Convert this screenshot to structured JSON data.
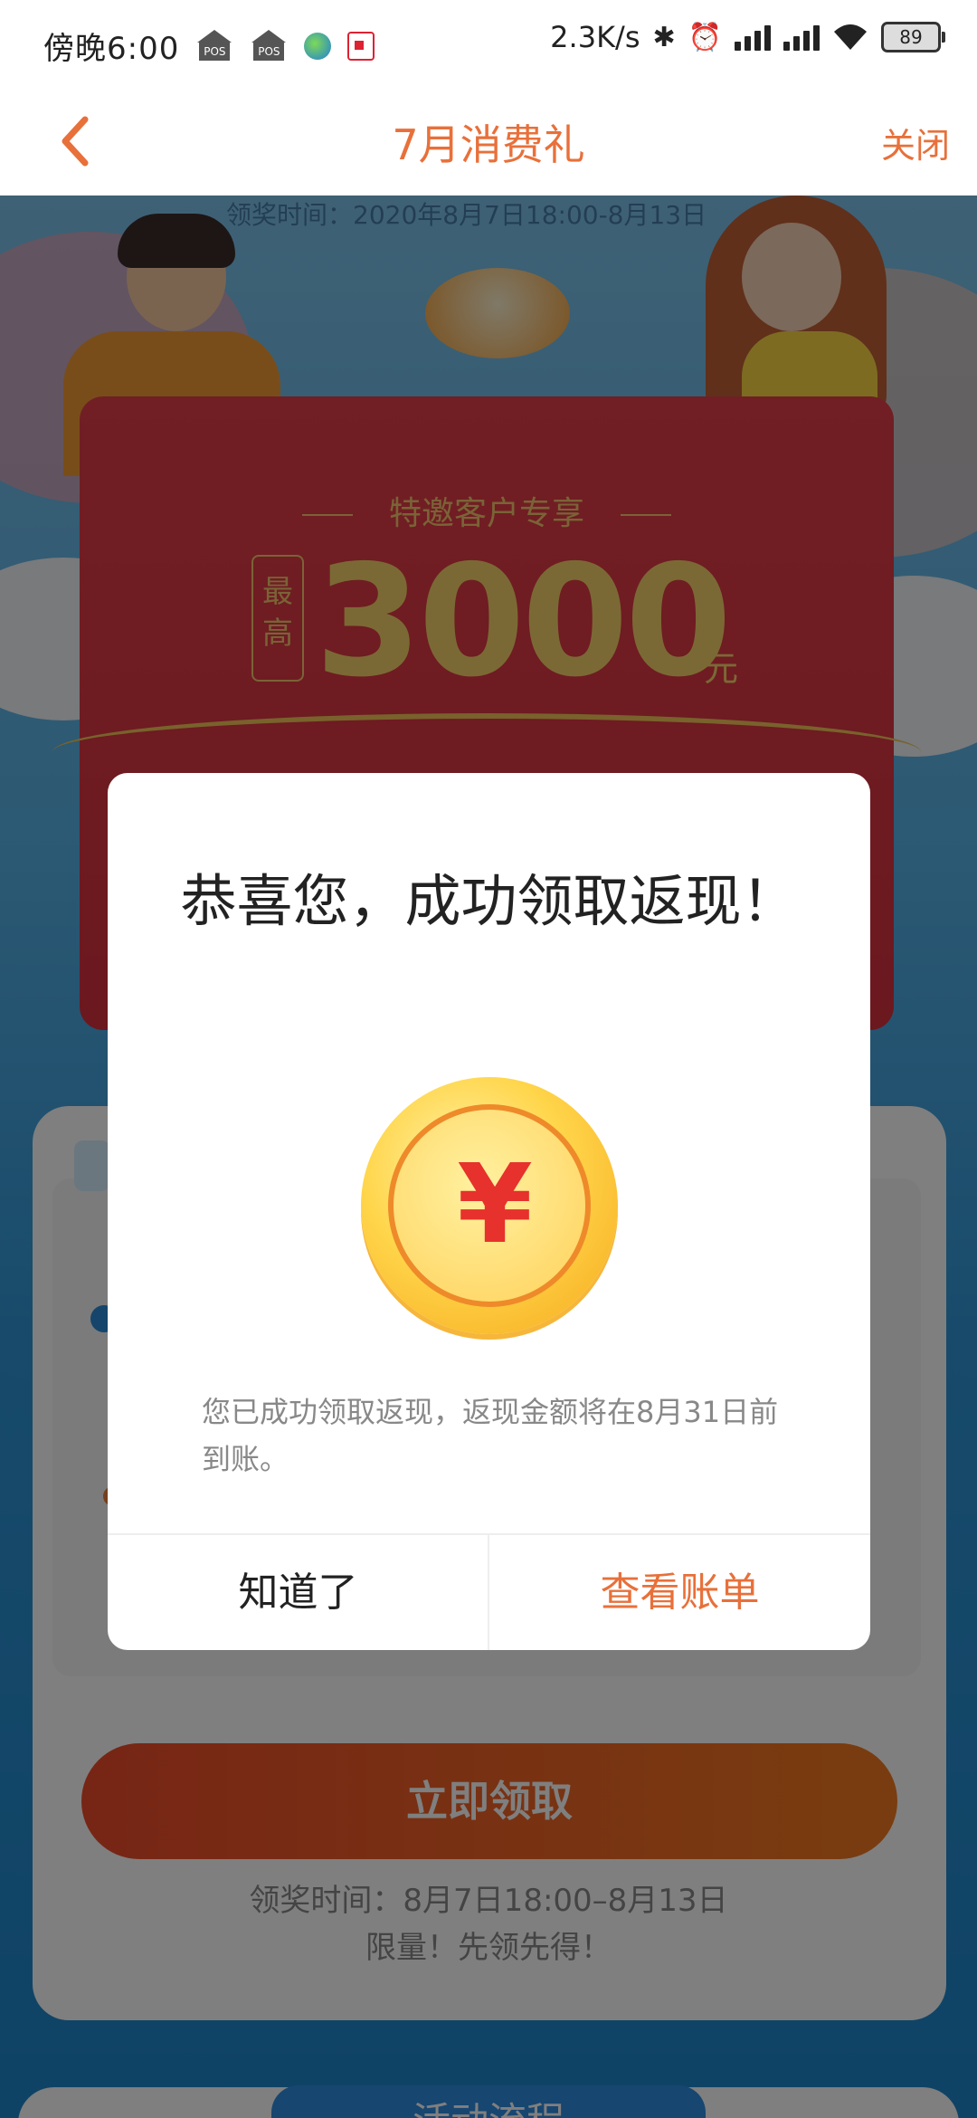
{
  "status_bar": {
    "time": "傍晚6:00",
    "net_speed": "2.3K/s",
    "battery": "89",
    "pos_label": "POS"
  },
  "navbar": {
    "title": "7月消费礼",
    "close": "关闭"
  },
  "background": {
    "hero_date": "领奖时间：2020年8月7日18:00-8月13日",
    "card_subtitle": "特邀客户专享",
    "badge": "最高",
    "amount": "3000",
    "unit": "元",
    "claim_button": "立即领取",
    "claim_time": "领奖时间：8月7日18:00–8月13日",
    "claim_limit": "限量！先领先得！",
    "flow_title": "活动流程"
  },
  "dialog": {
    "title": "恭喜您，成功领取返现！",
    "coin_symbol": "¥",
    "message": "您已成功领取返现，返现金额将在8月31日前到账。",
    "ok_button": "知道了",
    "bill_button": "查看账单"
  },
  "colors": {
    "accent": "#e8703a",
    "overlay": "rgba(0,0,0,0.5)"
  }
}
